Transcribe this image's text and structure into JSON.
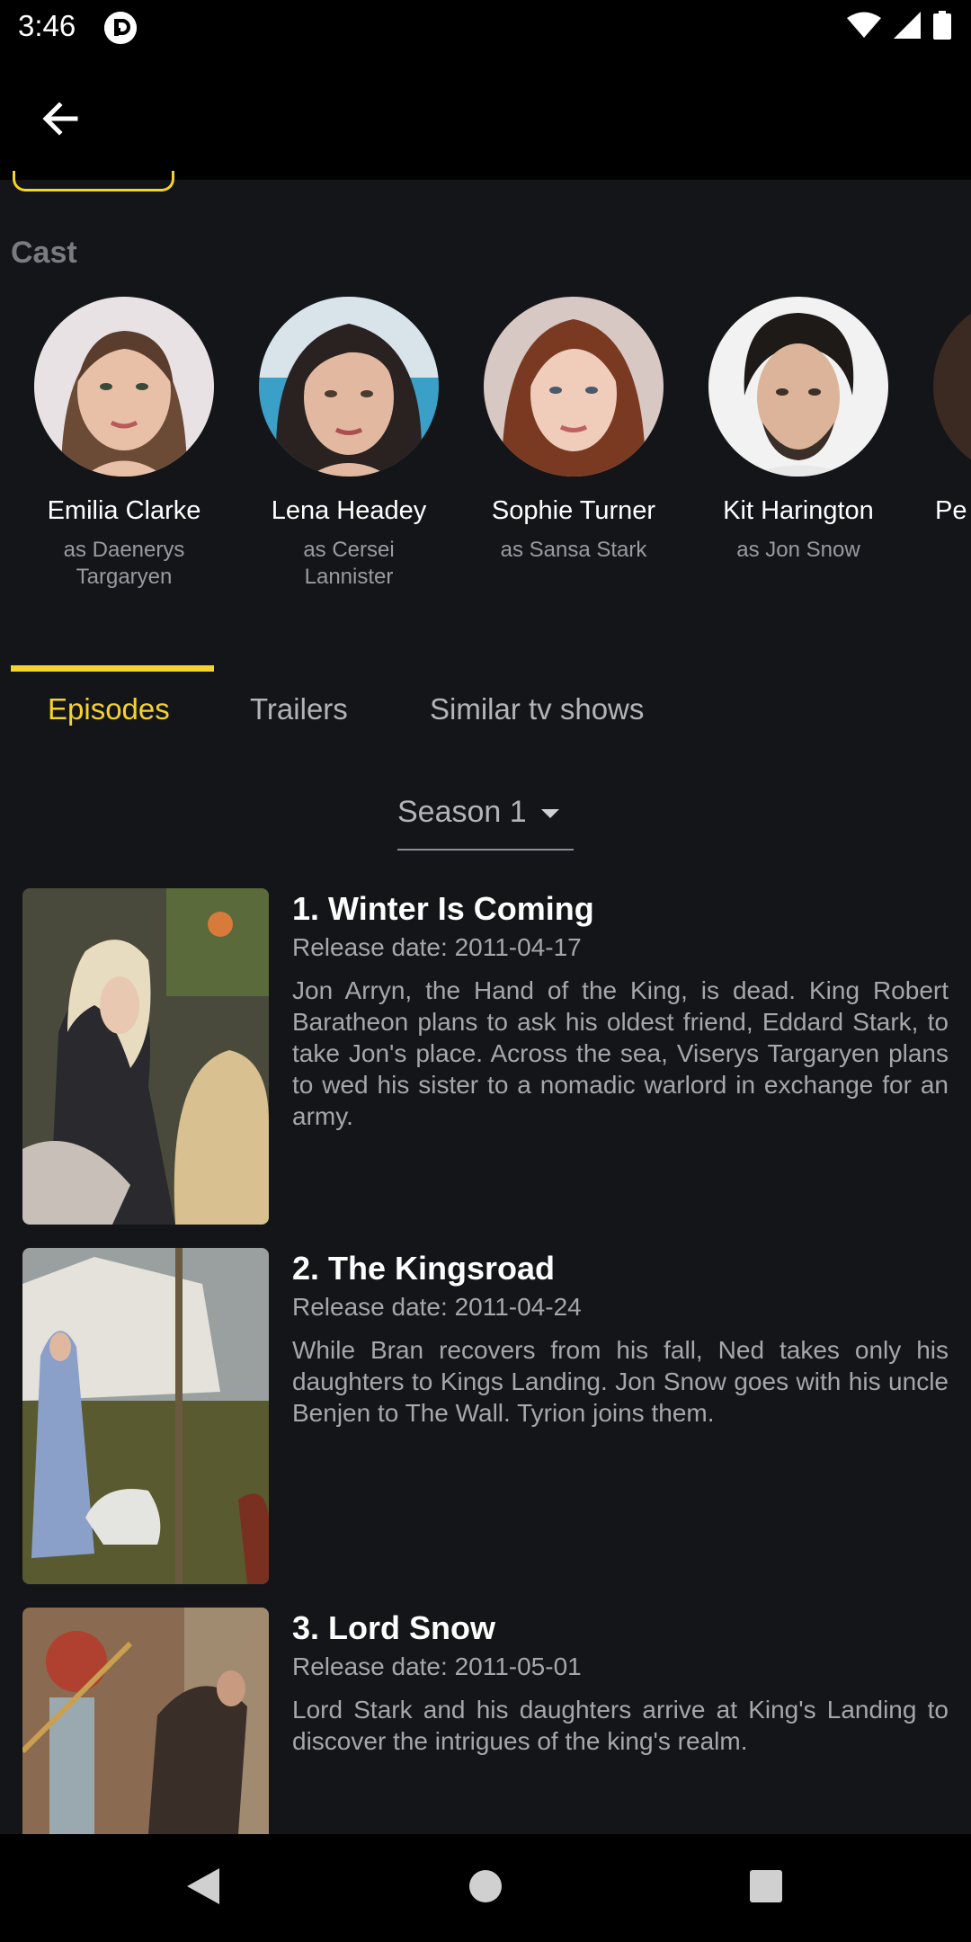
{
  "status_bar": {
    "time": "3:46"
  },
  "app_bar": {
    "back_icon": "arrow-left-icon"
  },
  "cast": {
    "heading": "Cast",
    "members": [
      {
        "name": "Emilia Clarke",
        "role": "as Daenerys Targaryen"
      },
      {
        "name": "Lena Headey",
        "role": "as Cersei Lannister"
      },
      {
        "name": "Sophie Turner",
        "role": "as Sansa Stark"
      },
      {
        "name": "Kit Harington",
        "role": "as Jon Snow"
      },
      {
        "name": "Pe",
        "role": ""
      }
    ]
  },
  "tabs": [
    {
      "label": "Episodes",
      "active": true
    },
    {
      "label": "Trailers",
      "active": false
    },
    {
      "label": "Similar tv shows",
      "active": false
    }
  ],
  "season_select": {
    "value": "Season 1"
  },
  "episodes": [
    {
      "title": "1. Winter Is Coming",
      "release": "Release date: 2011-04-17",
      "description": "Jon Arryn, the Hand of the King, is dead. King Robert Baratheon plans to ask his oldest friend, Eddard Stark, to take Jon's place. Across the sea, Viserys Targaryen plans to wed his sister to a nomadic warlord in exchange for an army."
    },
    {
      "title": "2. The Kingsroad",
      "release": "Release date: 2011-04-24",
      "description": "While Bran recovers from his fall, Ned takes only his daughters to Kings Landing. Jon Snow goes with his uncle Benjen to The Wall. Tyrion joins them."
    },
    {
      "title": "3. Lord Snow",
      "release": "Release date: 2011-05-01",
      "description": "Lord Stark and his daughters arrive at King's Landing to discover the intrigues of the king's realm."
    }
  ],
  "colors": {
    "accent": "#f5d22c",
    "background": "#141519",
    "bar": "#000000"
  }
}
